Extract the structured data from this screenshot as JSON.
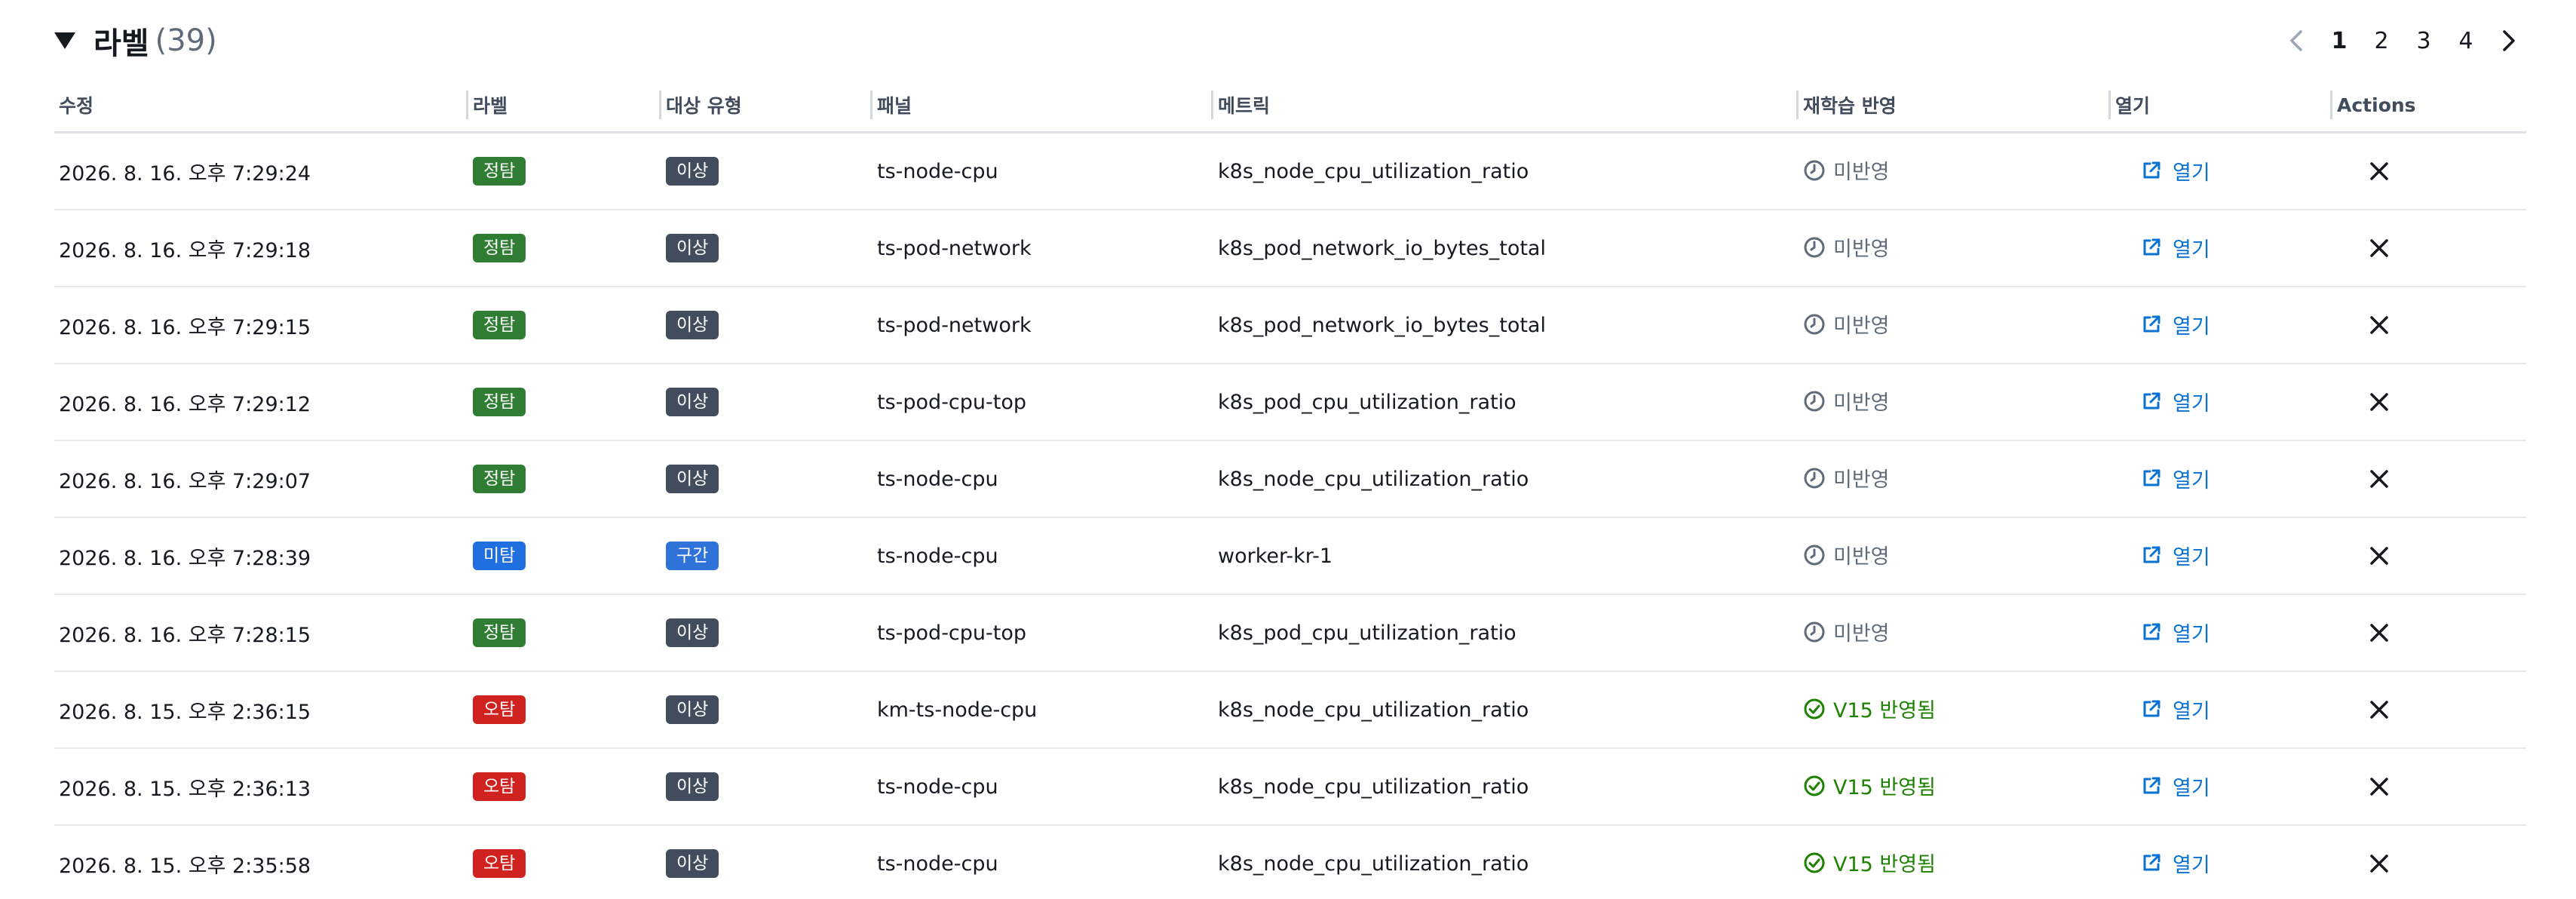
{
  "header": {
    "title": "라벨",
    "count": "(39)"
  },
  "pagination": {
    "pages": [
      "1",
      "2",
      "3",
      "4"
    ],
    "current": "1"
  },
  "columns": [
    "수정",
    "라벨",
    "대상 유형",
    "패널",
    "메트릭",
    "재학습 반영",
    "열기",
    "Actions"
  ],
  "colors": {
    "정탐": "#2e7d32",
    "미탐": "#1f6fe0",
    "오탐": "#d0221f",
    "이상": "#414d5c",
    "구간": "#2f73d8",
    "pending": "#5f6b7a",
    "applied": "#1d8102",
    "link": "#0972d3"
  },
  "rows": [
    {
      "modified": "2026. 8. 16. 오후 7:29:24",
      "label": "정탐",
      "target": "이상",
      "panel": "ts-node-cpu",
      "metric": "k8s_node_cpu_utilization_ratio",
      "retrain": "미반영",
      "retrain_status": "pending",
      "open": "열기"
    },
    {
      "modified": "2026. 8. 16. 오후 7:29:18",
      "label": "정탐",
      "target": "이상",
      "panel": "ts-pod-network",
      "metric": "k8s_pod_network_io_bytes_total",
      "retrain": "미반영",
      "retrain_status": "pending",
      "open": "열기"
    },
    {
      "modified": "2026. 8. 16. 오후 7:29:15",
      "label": "정탐",
      "target": "이상",
      "panel": "ts-pod-network",
      "metric": "k8s_pod_network_io_bytes_total",
      "retrain": "미반영",
      "retrain_status": "pending",
      "open": "열기"
    },
    {
      "modified": "2026. 8. 16. 오후 7:29:12",
      "label": "정탐",
      "target": "이상",
      "panel": "ts-pod-cpu-top",
      "metric": "k8s_pod_cpu_utilization_ratio",
      "retrain": "미반영",
      "retrain_status": "pending",
      "open": "열기"
    },
    {
      "modified": "2026. 8. 16. 오후 7:29:07",
      "label": "정탐",
      "target": "이상",
      "panel": "ts-node-cpu",
      "metric": "k8s_node_cpu_utilization_ratio",
      "retrain": "미반영",
      "retrain_status": "pending",
      "open": "열기"
    },
    {
      "modified": "2026. 8. 16. 오후 7:28:39",
      "label": "미탐",
      "target": "구간",
      "panel": "ts-node-cpu",
      "metric": "worker-kr-1",
      "retrain": "미반영",
      "retrain_status": "pending",
      "open": "열기"
    },
    {
      "modified": "2026. 8. 16. 오후 7:28:15",
      "label": "정탐",
      "target": "이상",
      "panel": "ts-pod-cpu-top",
      "metric": "k8s_pod_cpu_utilization_ratio",
      "retrain": "미반영",
      "retrain_status": "pending",
      "open": "열기"
    },
    {
      "modified": "2026. 8. 15. 오후 2:36:15",
      "label": "오탐",
      "target": "이상",
      "panel": "km-ts-node-cpu",
      "metric": "k8s_node_cpu_utilization_ratio",
      "retrain": "V15 반영됨",
      "retrain_status": "applied",
      "open": "열기"
    },
    {
      "modified": "2026. 8. 15. 오후 2:36:13",
      "label": "오탐",
      "target": "이상",
      "panel": "ts-node-cpu",
      "metric": "k8s_node_cpu_utilization_ratio",
      "retrain": "V15 반영됨",
      "retrain_status": "applied",
      "open": "열기"
    },
    {
      "modified": "2026. 8. 15. 오후 2:35:58",
      "label": "오탐",
      "target": "이상",
      "panel": "ts-node-cpu",
      "metric": "k8s_node_cpu_utilization_ratio",
      "retrain": "V15 반영됨",
      "retrain_status": "applied",
      "open": "열기"
    }
  ]
}
